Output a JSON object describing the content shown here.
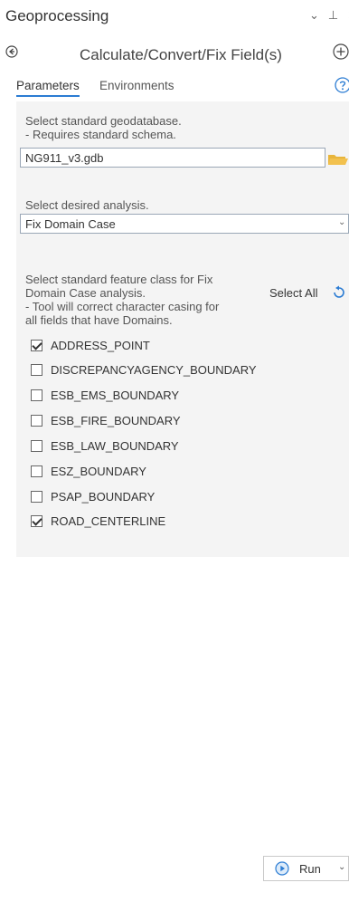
{
  "header": {
    "title": "Geoprocessing",
    "controls": [
      "⌄",
      "⊥",
      "✕"
    ],
    "tool_name": "Calculate/Convert/Fix Field(s)"
  },
  "tabs": [
    {
      "label": "Parameters",
      "active": true
    },
    {
      "label": "Environments",
      "active": false
    }
  ],
  "parameters": {
    "gdb_label_line1": "Select standard geodatabase.",
    "gdb_label_line2": " - Requires standard schema.",
    "gdb_value": "NG911_v3.gdb",
    "analysis_label": "Select desired analysis.",
    "analysis_value": "Fix Domain Case",
    "feature_class_label": [
      "Select standard feature class for Fix",
      "Domain Case analysis.",
      " - Tool will correct character casing for",
      "all fields that have Domains."
    ],
    "select_all_label": "Select All",
    "feature_classes": [
      {
        "label": "ADDRESS_POINT",
        "checked": true
      },
      {
        "label": "DISCREPANCYAGENCY_BOUNDARY",
        "checked": false
      },
      {
        "label": "ESB_EMS_BOUNDARY",
        "checked": false
      },
      {
        "label": "ESB_FIRE_BOUNDARY",
        "checked": false
      },
      {
        "label": "ESB_LAW_BOUNDARY",
        "checked": false
      },
      {
        "label": "ESZ_BOUNDARY",
        "checked": false
      },
      {
        "label": "PSAP_BOUNDARY",
        "checked": false
      },
      {
        "label": "ROAD_CENTERLINE",
        "checked": true
      }
    ]
  },
  "footer": {
    "run_label": "Run"
  },
  "colors": {
    "accent": "#2b7cd3",
    "panel_background": "#f4f4f4",
    "folder": "#f2c14e"
  }
}
